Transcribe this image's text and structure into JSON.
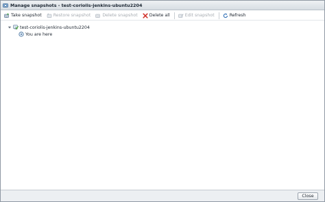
{
  "window": {
    "title": "Manage snapshots - test-coriolis-jenkins-ubuntu2204"
  },
  "toolbar": {
    "take_snapshot": "Take snapshot",
    "restore_snapshot": "Restore snapshot",
    "delete_snapshot": "Delete snapshot",
    "delete_all": "Delete all",
    "edit_snapshot": "Edit snapshot",
    "refresh": "Refresh"
  },
  "tree": {
    "root_label": "test-coriolis-jenkins-ubuntu2204",
    "current_label": "You are here"
  },
  "footer": {
    "close_label": "Close"
  },
  "icons": {
    "title": "snapshot-manager-icon",
    "take_snapshot": "camera-add-icon",
    "restore_snapshot": "restore-icon",
    "delete_snapshot": "snapshot-delete-icon",
    "delete_all": "red-x-icon",
    "edit_snapshot": "edit-icon",
    "refresh": "refresh-icon",
    "vm": "vm-icon",
    "current_state": "current-state-icon"
  },
  "colors": {
    "title_bar": "#d7dde3",
    "delete_red": "#d1322b",
    "refresh_blue": "#2f6fb6",
    "disabled_text": "#a6abb1",
    "vm_green": "#4ea43a"
  }
}
